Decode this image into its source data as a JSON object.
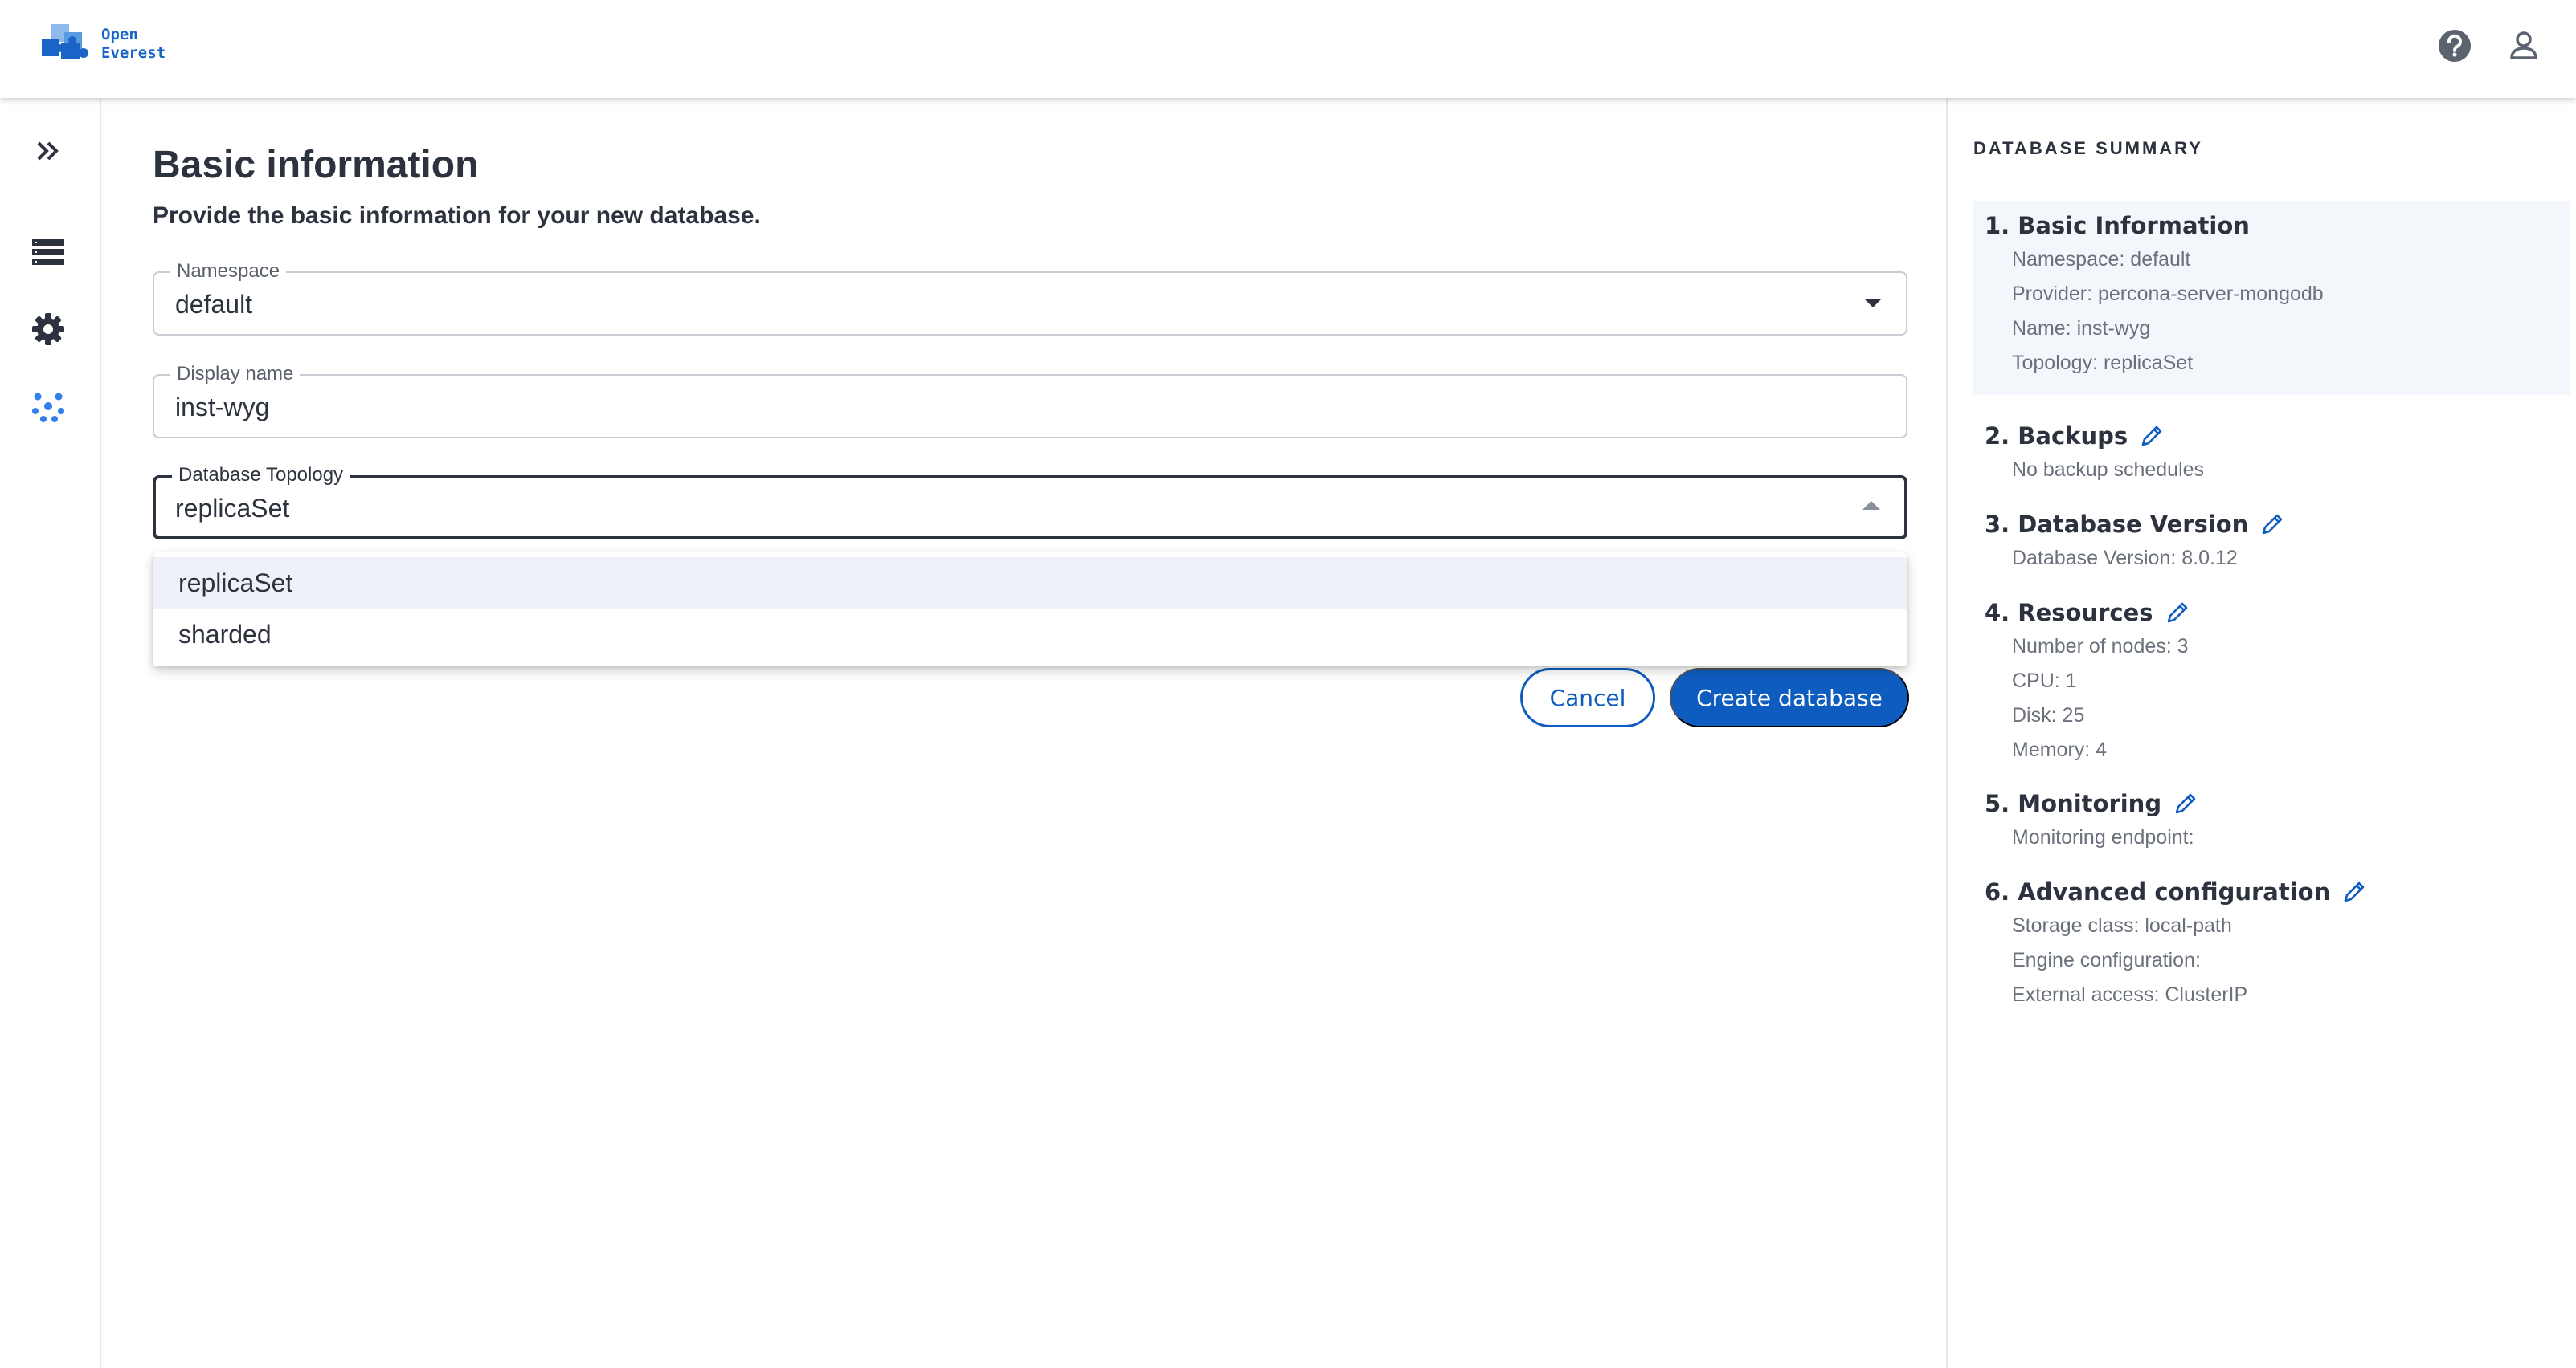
{
  "header": {
    "logo_line1": "Open",
    "logo_line2": "Everest",
    "help_icon": "help-circle-icon",
    "user_icon": "user-account-icon"
  },
  "nav": {
    "expand_icon": "double-chevron-right-icon",
    "items": [
      {
        "icon": "database-list-icon"
      },
      {
        "icon": "gear-icon"
      },
      {
        "icon": "dots-cluster-icon"
      }
    ]
  },
  "form": {
    "title": "Basic information",
    "subtitle": "Provide the basic information for your new database.",
    "namespace": {
      "label": "Namespace",
      "value": "default"
    },
    "display_name": {
      "label": "Display name",
      "value": "inst-wyg"
    },
    "topology": {
      "label": "Database Topology",
      "value": "replicaSet",
      "options": [
        "replicaSet",
        "sharded"
      ],
      "selected_index": 0
    },
    "cancel_label": "Cancel",
    "create_label": "Create database"
  },
  "summary": {
    "heading": "DATABASE SUMMARY",
    "sections": [
      {
        "title": "1. Basic Information",
        "lines": [
          "Namespace: default",
          "Provider: percona-server-mongodb",
          "Name: inst-wyg",
          "Topology: replicaSet"
        ]
      },
      {
        "title": "2. Backups",
        "lines": [
          "No backup schedules"
        ]
      },
      {
        "title": "3. Database Version",
        "lines": [
          "Database Version: 8.0.12"
        ]
      },
      {
        "title": "4. Resources",
        "lines": [
          "Number of nodes: 3",
          "CPU: 1",
          "Disk: 25",
          "Memory: 4"
        ]
      },
      {
        "title": "5. Monitoring",
        "lines": [
          "Monitoring endpoint:"
        ]
      },
      {
        "title": "6. Advanced configuration",
        "lines": [
          "Storage class: local-path",
          "Engine configuration:",
          "External access: ClusterIP"
        ]
      }
    ]
  },
  "colors": {
    "accent": "#0e5cbf",
    "logo_blue": "#1a64c8",
    "text": "#2c323e",
    "muted": "#6b717c",
    "nav_active": "#2f80ed"
  }
}
